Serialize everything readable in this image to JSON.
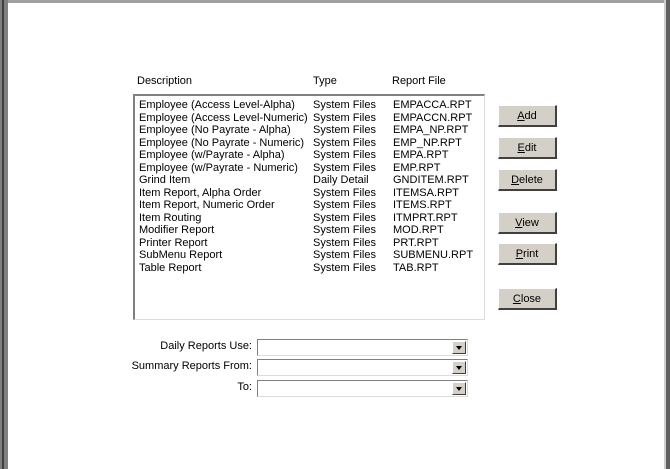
{
  "columns": {
    "description": "Description",
    "type": "Type",
    "report_file": "Report File"
  },
  "reports": [
    {
      "description": "Employee (Access Level-Alpha)",
      "type": "System Files",
      "file": "EMPACCA.RPT"
    },
    {
      "description": "Employee (Access Level-Numeric)",
      "type": "System Files",
      "file": "EMPACCN.RPT"
    },
    {
      "description": "Employee (No Payrate - Alpha)",
      "type": "System Files",
      "file": "EMPA_NP.RPT"
    },
    {
      "description": "Employee (No Payrate - Numeric)",
      "type": "System Files",
      "file": "EMP_NP.RPT"
    },
    {
      "description": "Employee (w/Payrate - Alpha)",
      "type": "System Files",
      "file": "EMPA.RPT"
    },
    {
      "description": "Employee (w/Payrate - Numeric)",
      "type": "System Files",
      "file": "EMP.RPT"
    },
    {
      "description": "Grind Item",
      "type": "Daily Detail",
      "file": "GNDITEM.RPT"
    },
    {
      "description": "Item Report, Alpha Order",
      "type": "System Files",
      "file": "ITEMSA.RPT"
    },
    {
      "description": "Item Report, Numeric Order",
      "type": "System Files",
      "file": "ITEMS.RPT"
    },
    {
      "description": "Item Routing",
      "type": "System Files",
      "file": "ITMPRT.RPT"
    },
    {
      "description": "Modifier Report",
      "type": "System Files",
      "file": "MOD.RPT"
    },
    {
      "description": "Printer Report",
      "type": "System Files",
      "file": "PRT.RPT"
    },
    {
      "description": "SubMenu Report",
      "type": "System Files",
      "file": "SUBMENU.RPT"
    },
    {
      "description": "Table Report",
      "type": "System Files",
      "file": "TAB.RPT"
    }
  ],
  "buttons": {
    "add": {
      "mnemonic": "A",
      "rest": "dd"
    },
    "edit": {
      "mnemonic": "E",
      "rest": "dit"
    },
    "delete": {
      "mnemonic": "D",
      "rest": "elete"
    },
    "view": {
      "mnemonic": "V",
      "rest": "iew"
    },
    "print": {
      "mnemonic": "P",
      "rest": "rint"
    },
    "close": {
      "mnemonic": "C",
      "rest": "lose"
    }
  },
  "fields": {
    "daily_reports_use": {
      "label": "Daily Reports Use:",
      "value": ""
    },
    "summary_reports_from": {
      "label": "Summary Reports From:",
      "value": ""
    },
    "to": {
      "label": "To:",
      "value": ""
    }
  }
}
